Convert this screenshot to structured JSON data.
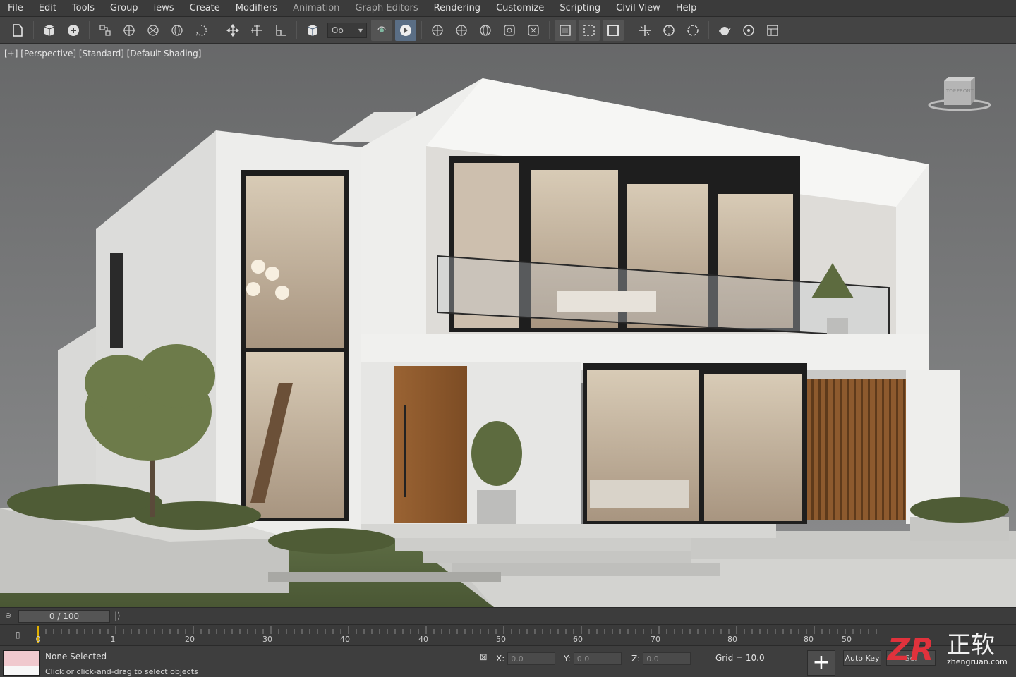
{
  "menu": [
    "File",
    "Edit",
    "Tools",
    "Group",
    "iews",
    "Create",
    "Modifiers",
    "Animation",
    "Graph Editors",
    "Rendering",
    "Customize",
    "Scripting",
    "Civil View",
    "Help"
  ],
  "toolbar": {
    "icons": [
      "new-scene-icon",
      "open-scene-icon",
      "save-scene-icon",
      "link-icon",
      "unlink-icon",
      "bind-warp-icon",
      "selection-filter-icon",
      "select-region-icon",
      "select-move-icon",
      "select-rotate-icon",
      "select-scale-icon",
      "3d-snap-icon",
      "snap-toggle-icon",
      "spinner-snap-icon",
      "angle-snap-icon",
      "percent-snap-icon",
      "mirror-icon",
      "align-icon",
      "layer-manager-icon",
      "curve-editor-icon",
      "schematic-view-icon",
      "material-editor-icon",
      "render-setup-icon",
      "rendered-frame-icon",
      "render-icon"
    ],
    "selection_combo": "Oo"
  },
  "viewport": {
    "label": "[+] [Perspective] [Standard] [Default Shading]",
    "viewcube_labels": [
      "TOP",
      "FRONT"
    ]
  },
  "timeline": {
    "frame_counter": "0 / 100",
    "ticks": [
      "0",
      "1",
      "20",
      "30",
      "40",
      "40",
      "50",
      "60",
      "70",
      "80",
      "80",
      "50"
    ]
  },
  "status": {
    "selection": "None Selected",
    "hint": "Click or click-and-drag to select objects",
    "x_label": "X:",
    "x_value": "0.0",
    "y_label": "Y:",
    "y_value": "0.0",
    "z_label": "Z:",
    "z_value": "0.0",
    "grid": "Grid = 10.0",
    "auto_key": "Auto Key",
    "set_key": "Sel"
  },
  "watermark": {
    "mark": "ZR",
    "chinese": "正软",
    "domain": "zhengruan.com"
  }
}
